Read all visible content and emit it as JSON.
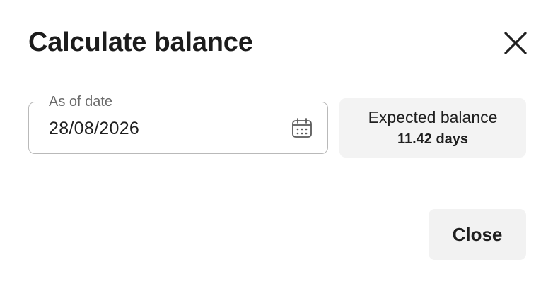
{
  "dialog": {
    "title": "Calculate balance",
    "close_icon": "close-icon"
  },
  "date_field": {
    "label": "As of date",
    "value": "28/08/2026",
    "icon": "calendar-icon"
  },
  "balance": {
    "label": "Expected balance",
    "value": "11.42 days"
  },
  "footer": {
    "close_label": "Close"
  }
}
